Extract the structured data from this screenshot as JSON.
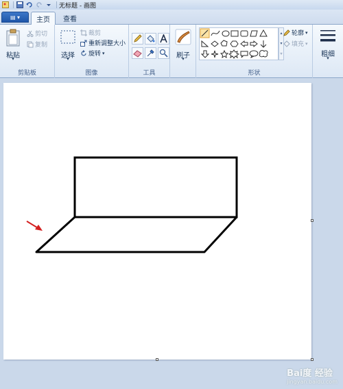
{
  "titlebar": {
    "title": "无标题 - 画图"
  },
  "file_button": {
    "label": "▤ ▾"
  },
  "tabs": [
    {
      "label": "主页"
    },
    {
      "label": "查看"
    }
  ],
  "clipboard": {
    "paste": "粘贴",
    "cut": "剪切",
    "copy": "复制",
    "group": "剪贴板"
  },
  "image": {
    "select": "选择",
    "crop": "裁剪",
    "resize": "重新调整大小",
    "rotate": "旋转",
    "group": "图像"
  },
  "tools": {
    "group": "工具"
  },
  "brushes": {
    "label": "刷子"
  },
  "shapes": {
    "outline": "轮廓",
    "fill": "填充",
    "group": "形状"
  },
  "size": {
    "label": "粗细"
  },
  "watermark": {
    "text": "Bai度 经验",
    "sub": "jingyan.baidu.com"
  },
  "colors": {
    "accent": "#1f56a8",
    "drawing": "#000000",
    "arrow": "#d42020"
  }
}
